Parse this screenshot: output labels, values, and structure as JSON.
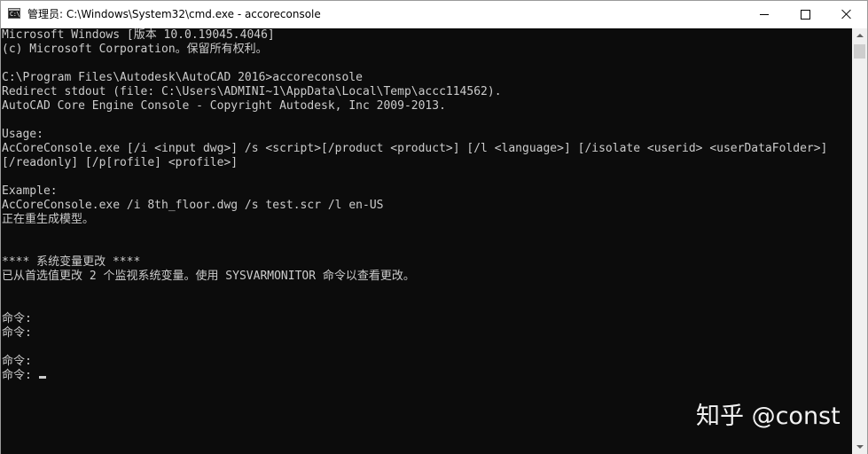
{
  "window": {
    "title": "管理员: C:\\Windows\\System32\\cmd.exe - accoreconsole",
    "app_icon": "cmd-icon",
    "app_icon_text": "C:\\"
  },
  "caption_buttons": {
    "minimize_icon": "minimize-icon",
    "maximize_icon": "maximize-icon",
    "close_icon": "close-icon"
  },
  "console": {
    "background": "#0c0c0c",
    "foreground": "#cccccc",
    "lines": [
      "Microsoft Windows [版本 10.0.19045.4046]",
      "(c) Microsoft Corporation。保留所有权利。",
      "",
      "C:\\Program Files\\Autodesk\\AutoCAD 2016>accoreconsole",
      "Redirect stdout (file: C:\\Users\\ADMINI~1\\AppData\\Local\\Temp\\accc114562).",
      "AutoCAD Core Engine Console - Copyright Autodesk, Inc 2009-2013.",
      "",
      "Usage:",
      "AcCoreConsole.exe [/i <input dwg>] /s <script>[/product <product>] [/l <language>] [/isolate <userid> <userDataFolder>]",
      "[/readonly] [/p[rofile] <profile>]",
      "",
      "Example:",
      "AcCoreConsole.exe /i 8th_floor.dwg /s test.scr /l en-US",
      "正在重生成模型。",
      "",
      "",
      "**** 系统变量更改 ****",
      "已从首选值更改 2 个监视系统变量。使用 SYSVARMONITOR 命令以查看更改。",
      "",
      "",
      "命令:",
      "命令:",
      "",
      "命令:",
      "命令: "
    ]
  },
  "watermark": {
    "text": "知乎 @const"
  }
}
